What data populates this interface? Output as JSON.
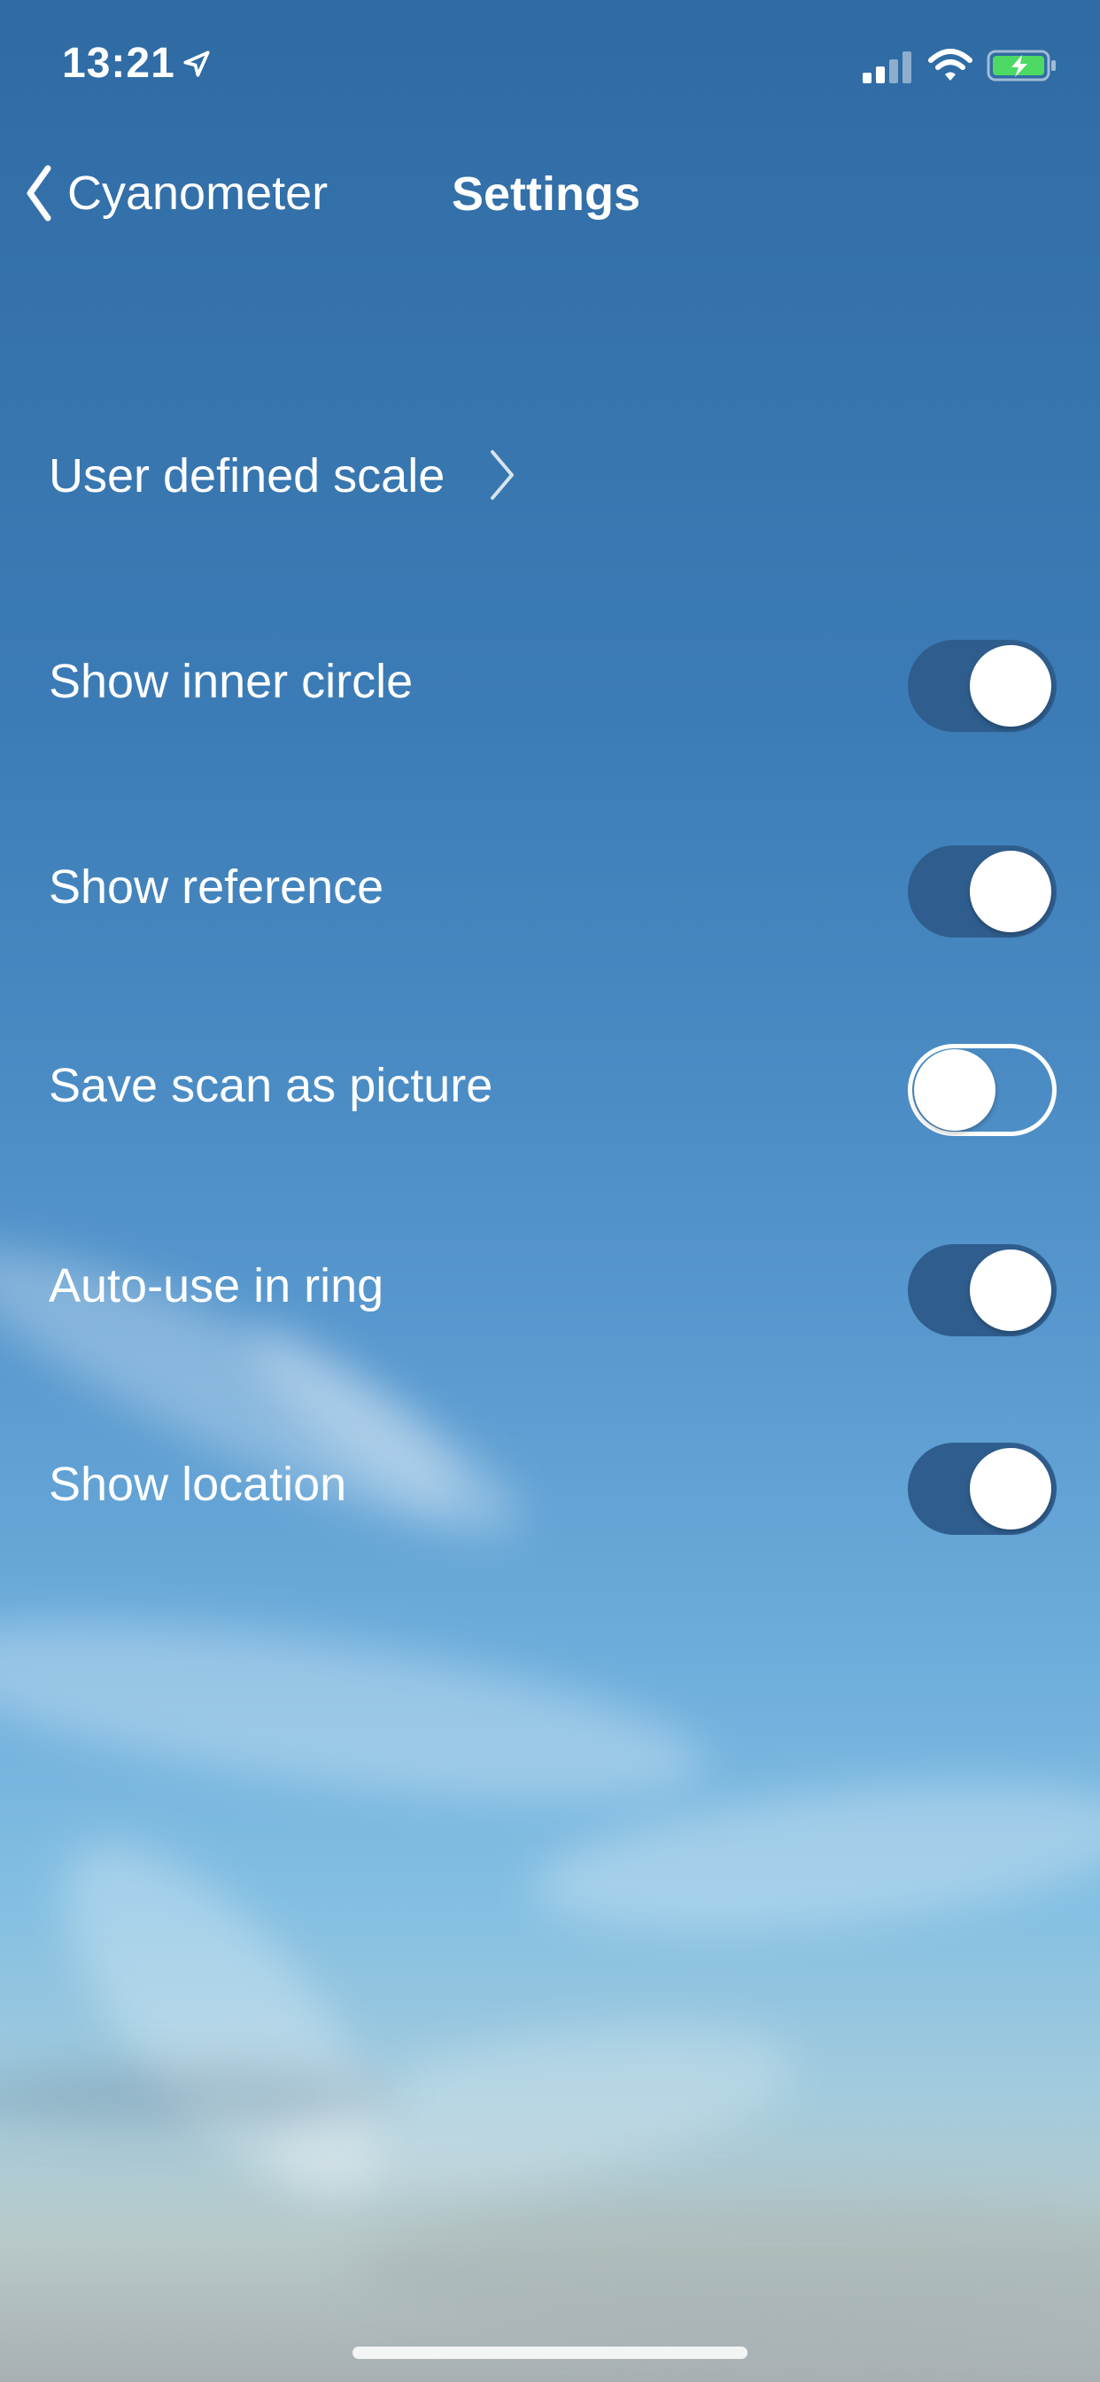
{
  "status_bar": {
    "time": "13:21",
    "icons": [
      "location-arrow-icon",
      "cellular-signal-icon",
      "wifi-icon",
      "battery-charging-icon"
    ],
    "battery_color": "#4cd964"
  },
  "nav": {
    "back_label": "Cyanometer",
    "title": "Settings"
  },
  "settings": {
    "user_scale": {
      "label": "User defined scale"
    },
    "items": [
      {
        "label": "Show inner circle",
        "on": true
      },
      {
        "label": "Show reference",
        "on": true
      },
      {
        "label": "Save scan as picture",
        "on": false
      },
      {
        "label": "Auto-use in ring",
        "on": true
      },
      {
        "label": "Show location",
        "on": true
      }
    ]
  },
  "colors": {
    "toggle_on": "#2f5e8e",
    "sky_top": "#2f6aa3",
    "sky_bottom": "#a8b0b3"
  }
}
